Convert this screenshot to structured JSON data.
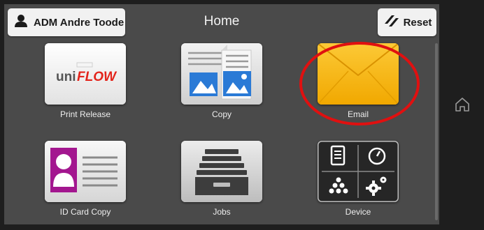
{
  "header": {
    "user_label": "ADM Andre Toode",
    "title": "Home",
    "reset_label": "Reset"
  },
  "tiles": [
    {
      "label": "Print Release",
      "icon": "uniflow-logo",
      "logo_text_uni": "uni",
      "logo_text_flow": "FLOW"
    },
    {
      "label": "Copy",
      "icon": "copy-icon"
    },
    {
      "label": "Email",
      "icon": "envelope-icon"
    },
    {
      "label": "ID Card Copy",
      "icon": "id-card-icon"
    },
    {
      "label": "Jobs",
      "icon": "jobs-drawer-icon"
    },
    {
      "label": "Device",
      "icon": "device-icon"
    }
  ],
  "side": {
    "home_icon": "home-icon"
  },
  "colors": {
    "background": "#4a4a4a",
    "button": "#f1f1f1",
    "email_tile": "#f5b70e",
    "uniflow_red": "#e3241b",
    "copy_blue": "#2a7ad6",
    "id_card_purple": "#a3178f",
    "highlight_circle": "#e01010"
  }
}
